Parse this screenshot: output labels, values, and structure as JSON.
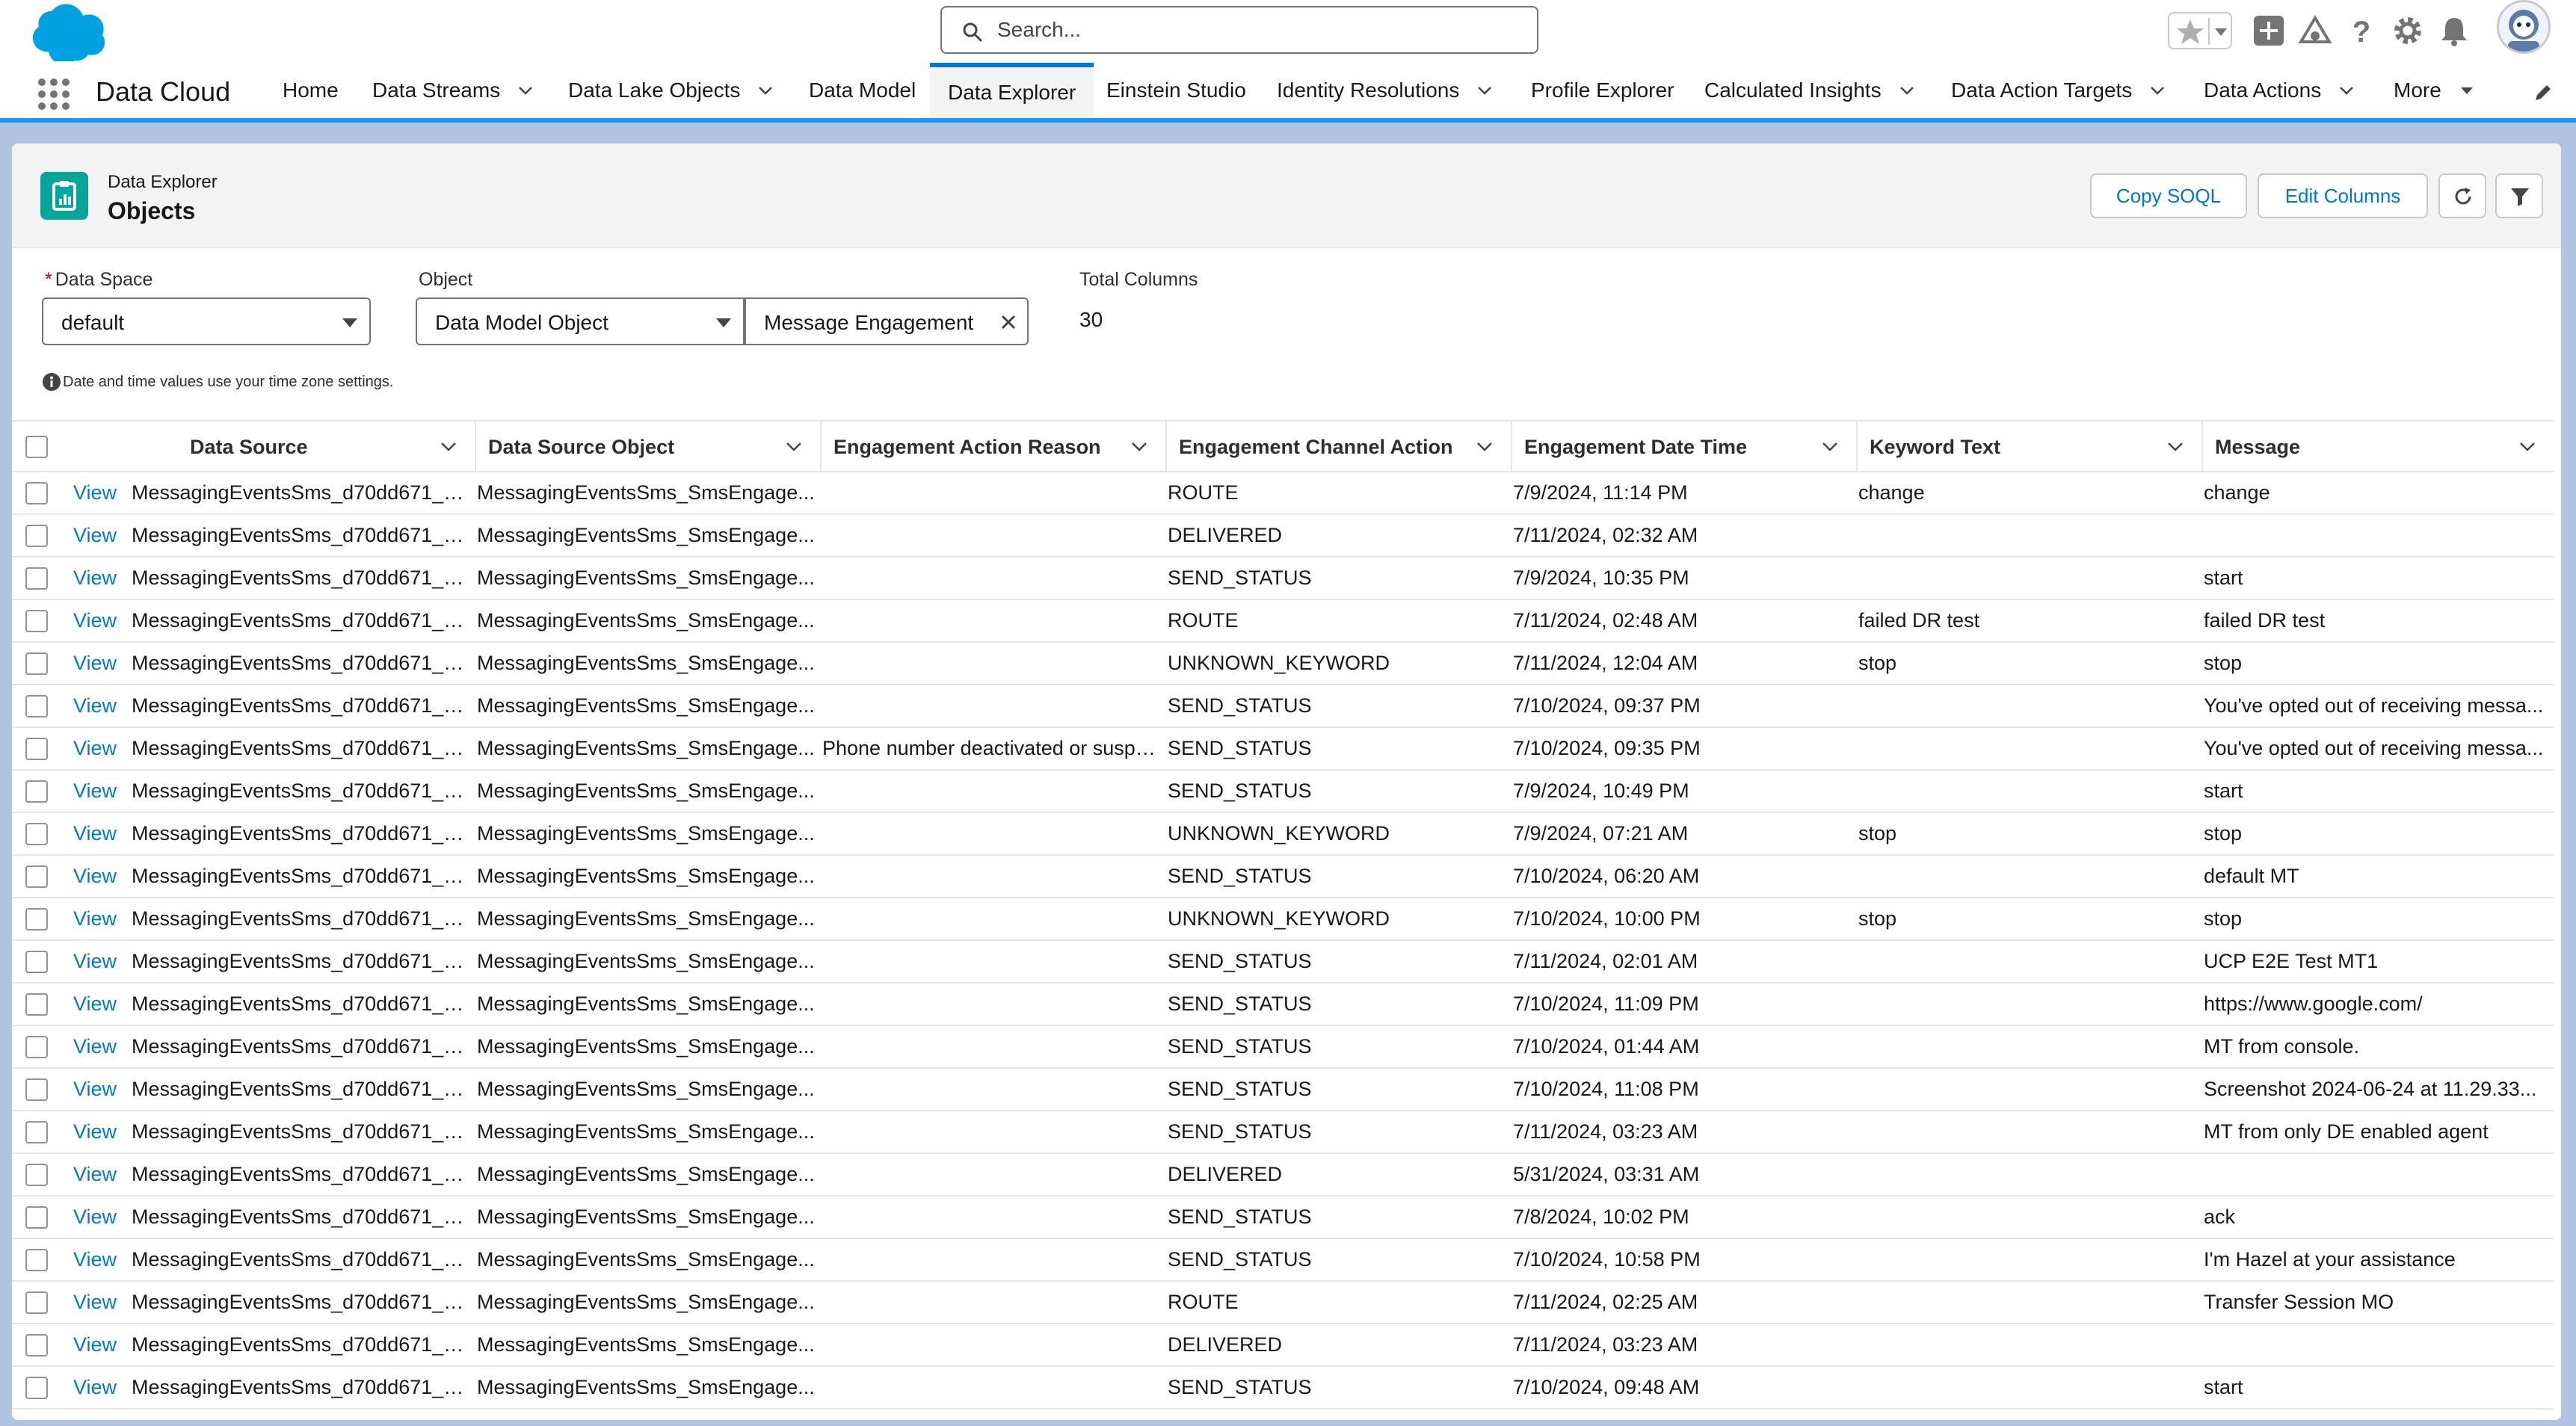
{
  "header": {
    "search_placeholder": "Search..."
  },
  "nav": {
    "app_name": "Data Cloud",
    "items": [
      {
        "label": "Home",
        "has_menu": false
      },
      {
        "label": "Data Streams",
        "has_menu": true
      },
      {
        "label": "Data Lake Objects",
        "has_menu": true
      },
      {
        "label": "Data Model",
        "has_menu": false
      },
      {
        "label": "Data Explorer",
        "has_menu": false,
        "active": true
      },
      {
        "label": "Einstein Studio",
        "has_menu": false
      },
      {
        "label": "Identity Resolutions",
        "has_menu": true
      },
      {
        "label": "Profile Explorer",
        "has_menu": false
      },
      {
        "label": "Calculated Insights",
        "has_menu": true
      },
      {
        "label": "Data Action Targets",
        "has_menu": true
      },
      {
        "label": "Data Actions",
        "has_menu": true
      },
      {
        "label": "More",
        "has_menu": true
      }
    ]
  },
  "page": {
    "eyebrow": "Data Explorer",
    "title": "Objects",
    "copy_soql": "Copy SOQL",
    "edit_columns": "Edit Columns"
  },
  "filters": {
    "data_space_label": "Data Space",
    "data_space_value": "default",
    "object_label": "Object",
    "object_type_value": "Data Model Object",
    "object_value": "Message Engagement",
    "total_columns_label": "Total Columns",
    "total_columns_value": "30",
    "note": "Date and time values use your time zone settings."
  },
  "table": {
    "columns": [
      "Data Source",
      "Data Source Object",
      "Engagement Action Reason",
      "Engagement Channel Action",
      "Engagement Date Time",
      "Keyword Text",
      "Message"
    ],
    "view_label": "View",
    "rows": [
      [
        "MessagingEventsSms_d70dd671_1f...",
        "MessagingEventsSms_SmsEngage...",
        "",
        "ROUTE",
        "7/9/2024, 11:14 PM",
        "change",
        "change"
      ],
      [
        "MessagingEventsSms_d70dd671_1f...",
        "MessagingEventsSms_SmsEngage...",
        "",
        "DELIVERED",
        "7/11/2024, 02:32 AM",
        "",
        ""
      ],
      [
        "MessagingEventsSms_d70dd671_1f...",
        "MessagingEventsSms_SmsEngage...",
        "",
        "SEND_STATUS",
        "7/9/2024, 10:35 PM",
        "",
        "start"
      ],
      [
        "MessagingEventsSms_d70dd671_1f...",
        "MessagingEventsSms_SmsEngage...",
        "",
        "ROUTE",
        "7/11/2024, 02:48 AM",
        "failed DR test",
        "failed DR test"
      ],
      [
        "MessagingEventsSms_d70dd671_1f...",
        "MessagingEventsSms_SmsEngage...",
        "",
        "UNKNOWN_KEYWORD",
        "7/11/2024, 12:04 AM",
        "stop",
        "stop"
      ],
      [
        "MessagingEventsSms_d70dd671_1f...",
        "MessagingEventsSms_SmsEngage...",
        "",
        "SEND_STATUS",
        "7/10/2024, 09:37 PM",
        "",
        "You've opted out of receiving messa..."
      ],
      [
        "MessagingEventsSms_d70dd671_1f...",
        "MessagingEventsSms_SmsEngage...",
        "Phone number deactivated or suspe...",
        "SEND_STATUS",
        "7/10/2024, 09:35 PM",
        "",
        "You've opted out of receiving messa..."
      ],
      [
        "MessagingEventsSms_d70dd671_1f...",
        "MessagingEventsSms_SmsEngage...",
        "",
        "SEND_STATUS",
        "7/9/2024, 10:49 PM",
        "",
        "start"
      ],
      [
        "MessagingEventsSms_d70dd671_1f...",
        "MessagingEventsSms_SmsEngage...",
        "",
        "UNKNOWN_KEYWORD",
        "7/9/2024, 07:21 AM",
        "stop",
        "stop"
      ],
      [
        "MessagingEventsSms_d70dd671_1f...",
        "MessagingEventsSms_SmsEngage...",
        "",
        "SEND_STATUS",
        "7/10/2024, 06:20 AM",
        "",
        "default MT"
      ],
      [
        "MessagingEventsSms_d70dd671_1f...",
        "MessagingEventsSms_SmsEngage...",
        "",
        "UNKNOWN_KEYWORD",
        "7/10/2024, 10:00 PM",
        "stop",
        "stop"
      ],
      [
        "MessagingEventsSms_d70dd671_1f...",
        "MessagingEventsSms_SmsEngage...",
        "",
        "SEND_STATUS",
        "7/11/2024, 02:01 AM",
        "",
        "UCP E2E Test MT1"
      ],
      [
        "MessagingEventsSms_d70dd671_1f...",
        "MessagingEventsSms_SmsEngage...",
        "",
        "SEND_STATUS",
        "7/10/2024, 11:09 PM",
        "",
        "https://www.google.com/"
      ],
      [
        "MessagingEventsSms_d70dd671_1f...",
        "MessagingEventsSms_SmsEngage...",
        "",
        "SEND_STATUS",
        "7/10/2024, 01:44 AM",
        "",
        "MT from console."
      ],
      [
        "MessagingEventsSms_d70dd671_1f...",
        "MessagingEventsSms_SmsEngage...",
        "",
        "SEND_STATUS",
        "7/10/2024, 11:08 PM",
        "",
        "Screenshot 2024-06-24 at 11.29.33..."
      ],
      [
        "MessagingEventsSms_d70dd671_1f...",
        "MessagingEventsSms_SmsEngage...",
        "",
        "SEND_STATUS",
        "7/11/2024, 03:23 AM",
        "",
        "MT from only DE enabled agent"
      ],
      [
        "MessagingEventsSms_d70dd671_1f...",
        "MessagingEventsSms_SmsEngage...",
        "",
        "DELIVERED",
        "5/31/2024, 03:31 AM",
        "",
        ""
      ],
      [
        "MessagingEventsSms_d70dd671_1f...",
        "MessagingEventsSms_SmsEngage...",
        "",
        "SEND_STATUS",
        "7/8/2024, 10:02 PM",
        "",
        "ack"
      ],
      [
        "MessagingEventsSms_d70dd671_1f...",
        "MessagingEventsSms_SmsEngage...",
        "",
        "SEND_STATUS",
        "7/10/2024, 10:58 PM",
        "",
        "I'm Hazel at your assistance"
      ],
      [
        "MessagingEventsSms_d70dd671_1f...",
        "MessagingEventsSms_SmsEngage...",
        "",
        "ROUTE",
        "7/11/2024, 02:25 AM",
        "",
        "Transfer Session MO"
      ],
      [
        "MessagingEventsSms_d70dd671_1f...",
        "MessagingEventsSms_SmsEngage...",
        "",
        "DELIVERED",
        "7/11/2024, 03:23 AM",
        "",
        ""
      ],
      [
        "MessagingEventsSms_d70dd671_1f...",
        "MessagingEventsSms_SmsEngage...",
        "",
        "SEND_STATUS",
        "7/10/2024, 09:48 AM",
        "",
        "start"
      ]
    ]
  },
  "colors": {
    "brand_blue": "#0176d3",
    "nav_accent": "#1b96ff",
    "object_icon": "#06a59a",
    "background": "#b0c4df"
  },
  "icons": [
    "salesforce-cloud-logo",
    "search-icon",
    "favorite-star-icon",
    "chevron-down-icon",
    "add-icon",
    "trailhead-icon",
    "help-icon",
    "gear-icon",
    "bell-icon",
    "avatar",
    "app-launcher-icon",
    "edit-pencil-icon",
    "data-explorer-icon",
    "refresh-icon",
    "filter-icon",
    "close-icon",
    "info-icon"
  ]
}
